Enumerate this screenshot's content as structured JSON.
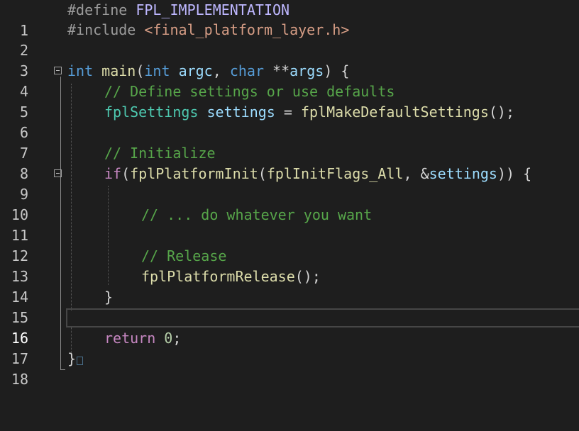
{
  "editor": {
    "line_numbers": [
      "1",
      "2",
      "3",
      "4",
      "5",
      "6",
      "7",
      "8",
      "9",
      "10",
      "11",
      "12",
      "13",
      "14",
      "15",
      "16",
      "17",
      "18"
    ],
    "current_line": "16",
    "lines": {
      "l1": {
        "directive": "#define",
        "macro": "FPL_IMPLEMENTATION"
      },
      "l2": {
        "directive": "#include",
        "header": "<final_platform_layer.h>"
      },
      "l4": {
        "kw_int": "int",
        "fn_main": "main",
        "p_open": "(",
        "kw_int2": "int",
        "argc": "argc",
        "comma": ",",
        "kw_char": "char",
        "stars": "**",
        "args": "args",
        "close": ")",
        "brace": "{"
      },
      "l5": {
        "comment": "// Define settings or use defaults"
      },
      "l6": {
        "type": "fplSettings",
        "var": "settings",
        "eq": "=",
        "fn": "fplMakeDefaultSettings",
        "rest": "();"
      },
      "l8": {
        "comment": "// Initialize"
      },
      "l9": {
        "kw_if": "if",
        "p1": "(",
        "fn": "fplPlatformInit",
        "p2": "(",
        "flag": "fplInitFlags_All",
        "comma": ",",
        "amp": "&",
        "var": "settings",
        "close": "))",
        "brace": "{"
      },
      "l11": {
        "comment": "// ... do whatever you want"
      },
      "l13": {
        "comment": "// Release"
      },
      "l14": {
        "fn": "fplPlatformRelease",
        "rest": "();"
      },
      "l15": {
        "brace": "}"
      },
      "l17": {
        "kw_return": "return",
        "num": "0",
        "semi": ";"
      },
      "l18": {
        "brace": "}"
      }
    }
  },
  "colors": {
    "background": "#1e1e1e",
    "keyword": "#569cd6",
    "control": "#c586c0",
    "function": "#dcdcaa",
    "type": "#4ec9b0",
    "variable": "#9cdcfe",
    "comment": "#57a64a",
    "string": "#d69d85",
    "macro": "#beb7ff"
  },
  "icons": [
    "fold-collapse-icon"
  ]
}
